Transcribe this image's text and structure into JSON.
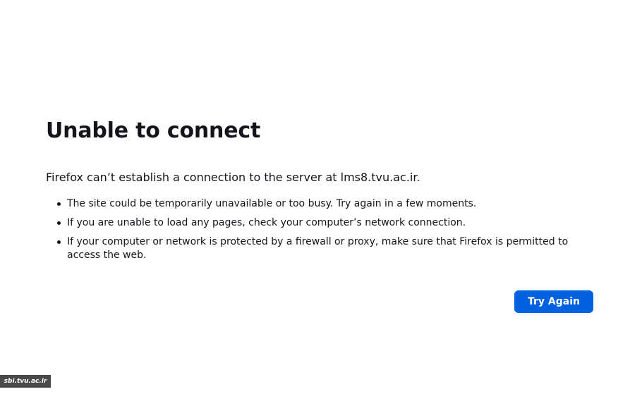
{
  "error_page": {
    "title": "Unable to connect",
    "intro": "Firefox can’t establish a connection to the server at lms8.tvu.ac.ir.",
    "reasons": [
      "The site could be temporarily unavailable or too busy. Try again in a few moments.",
      "If you are unable to load any pages, check your computer’s network connection.",
      "If your computer or network is protected by a firewall or proxy, make sure that Firefox is permitted to access the web."
    ],
    "try_again_label": "Try Again"
  },
  "watermark": {
    "text": "sbi.tvu.ac.ir"
  },
  "colors": {
    "button": "#0061e0",
    "text": "#15141a",
    "background": "#ffffff"
  }
}
